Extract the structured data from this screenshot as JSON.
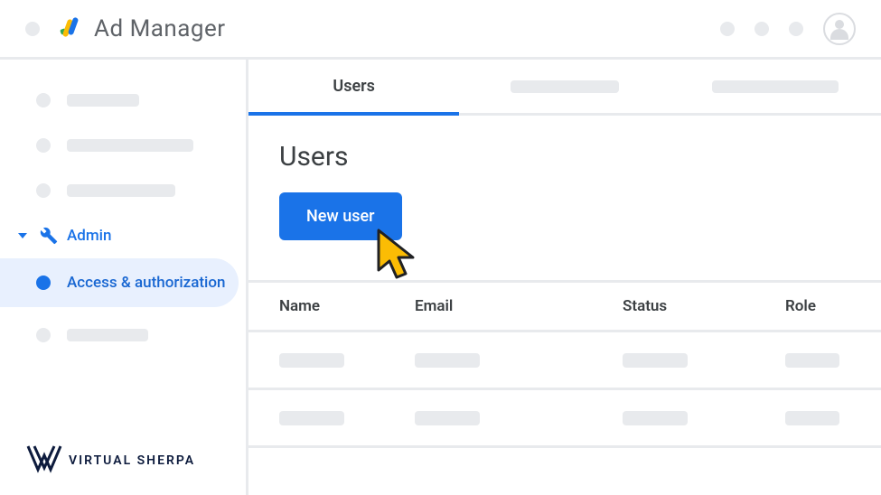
{
  "header": {
    "title": "Ad Manager"
  },
  "sidebar": {
    "admin_label": "Admin",
    "active_label": "Access & authorization"
  },
  "tabs": {
    "active": "Users"
  },
  "page": {
    "heading": "Users",
    "new_button": "New user"
  },
  "table": {
    "columns": {
      "name": "Name",
      "email": "Email",
      "status": "Status",
      "role": "Role"
    }
  },
  "watermark": {
    "text": "VIRTUAL SHERPA"
  }
}
